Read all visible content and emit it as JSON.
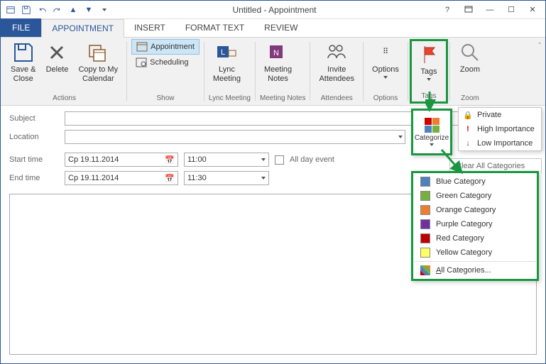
{
  "title": "Untitled - Appointment",
  "qat": {
    "save": "Save",
    "undo": "Undo",
    "redo": "Redo"
  },
  "tabs": {
    "file": "FILE",
    "appointment": "APPOINTMENT",
    "insert": "INSERT",
    "format": "FORMAT TEXT",
    "review": "REVIEW"
  },
  "ribbon": {
    "actions": {
      "saveClose": "Save &\nClose",
      "delete": "Delete",
      "copy": "Copy to My\nCalendar",
      "label": "Actions"
    },
    "show": {
      "appointment": "Appointment",
      "scheduling": "Scheduling",
      "label": "Show"
    },
    "lync": {
      "btn": "Lync\nMeeting",
      "label": "Lync Meeting"
    },
    "notes": {
      "btn": "Meeting\nNotes",
      "label": "Meeting Notes"
    },
    "attendees": {
      "invite": "Invite\nAttendees",
      "label": "Attendees"
    },
    "options": {
      "btn": "Options",
      "label": "Options"
    },
    "tags": {
      "btn": "Tags",
      "label": "Tags"
    },
    "zoom": {
      "btn": "Zoom",
      "label": "Zoom"
    }
  },
  "form": {
    "subjectLabel": "Subject",
    "subject": "",
    "locationLabel": "Location",
    "location": "",
    "startLabel": "Start time",
    "startDate": "Cp 19.11.2014",
    "startTime": "11:00",
    "endLabel": "End time",
    "endDate": "Cp 19.11.2014",
    "endTime": "11:30",
    "allDay": "All day event"
  },
  "categorize": {
    "label": "Categorize"
  },
  "sideMenu": {
    "private": "Private",
    "high": "High Importance",
    "low": "Low Importance"
  },
  "clearAll": "Clear All Categories",
  "categories": [
    {
      "label": "Blue Category",
      "color": "#4f81bd"
    },
    {
      "label": "Green Category",
      "color": "#76b041"
    },
    {
      "label": "Orange Category",
      "color": "#ed7d31"
    },
    {
      "label": "Purple Category",
      "color": "#7030a0"
    },
    {
      "label": "Red Category",
      "color": "#c00000"
    },
    {
      "label": "Yellow Category",
      "color": "#ffff66"
    }
  ],
  "allCategories": "All Categories..."
}
